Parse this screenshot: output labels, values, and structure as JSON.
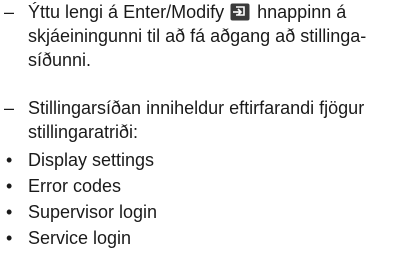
{
  "paragraphs": {
    "first": {
      "marker": "–",
      "before_icon": "Ýttu lengi á Enter/Modify",
      "icon": "enter-modify-icon",
      "after_icon": "hnappinn á skjáeiningunni til að fá aðgang að stillinga­síðunni."
    },
    "second": {
      "marker": "–",
      "text": "Stillingarsíðan inniheldur eftirfarandi fjögur stillingaratriði:"
    }
  },
  "bullet_marker": "•",
  "items": [
    {
      "label": "Display settings"
    },
    {
      "label": "Error codes"
    },
    {
      "label": "Supervisor login"
    },
    {
      "label": "Service login"
    }
  ],
  "colors": {
    "text": "#1a1a1a",
    "icon_fill": "#3a3a3a",
    "icon_symbol": "#ffffff"
  }
}
